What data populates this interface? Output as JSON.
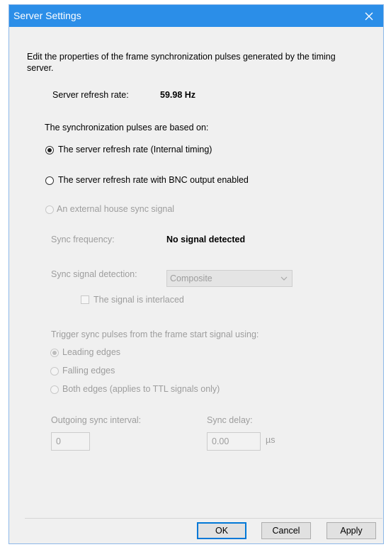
{
  "window": {
    "title": "Server Settings"
  },
  "intro": "Edit the properties of the frame synchronization pulses generated by the timing server.",
  "refresh": {
    "label": "Server refresh rate:",
    "value": "59.98 Hz"
  },
  "pulses_heading": "The synchronization pulses are based on:",
  "source_options": [
    {
      "label": "The server refresh rate (Internal timing)",
      "selected": true,
      "enabled": true
    },
    {
      "label": "The server refresh rate with BNC output enabled",
      "selected": false,
      "enabled": true
    },
    {
      "label": "An external house sync signal",
      "selected": false,
      "enabled": false
    }
  ],
  "sync_frequency": {
    "label": "Sync frequency:",
    "value": "No signal detected"
  },
  "detection": {
    "label": "Sync signal detection:",
    "selected": "Composite"
  },
  "interlaced": {
    "label": "The signal is interlaced",
    "checked": false
  },
  "trigger_heading": "Trigger sync pulses from the frame start signal using:",
  "edge_options": [
    {
      "label": "Leading edges",
      "selected": true
    },
    {
      "label": "Falling edges",
      "selected": false
    },
    {
      "label": "Both edges (applies to TTL signals only)",
      "selected": false
    }
  ],
  "interval": {
    "label": "Outgoing sync interval:",
    "value": "0"
  },
  "delay": {
    "label": "Sync delay:",
    "value": "0.00",
    "unit": "µs"
  },
  "buttons": {
    "ok": "OK",
    "cancel": "Cancel",
    "apply": "Apply"
  },
  "icons": {
    "close": "close-icon",
    "dropdown": "chevron-down-icon"
  },
  "colors": {
    "titlebar": "#2b8ee8",
    "dialog_bg": "#f0f0f0",
    "disabled_text": "#9d9d9d",
    "default_button_border": "#0078d7"
  }
}
